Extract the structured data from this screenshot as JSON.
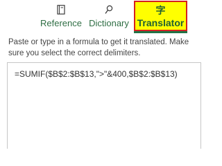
{
  "tabs": [
    {
      "label": "Reference",
      "icon": "book-icon"
    },
    {
      "label": "Dictionary",
      "icon": "search-icon"
    },
    {
      "label": "Translator",
      "icon": "translate-icon",
      "icon_glyph": "字",
      "selected": true
    }
  ],
  "instructions": "Paste or type in a formula to get it translated. Make sure you select the correct delimiters.",
  "formula": "=SUMIF($B$2:$B$13,\">\"&400,$B$2:$B$13)",
  "colors": {
    "tab_text": "#2f6e44",
    "accent": "#217346",
    "highlight": "#ffff00",
    "highlight_border": "#d42020"
  }
}
